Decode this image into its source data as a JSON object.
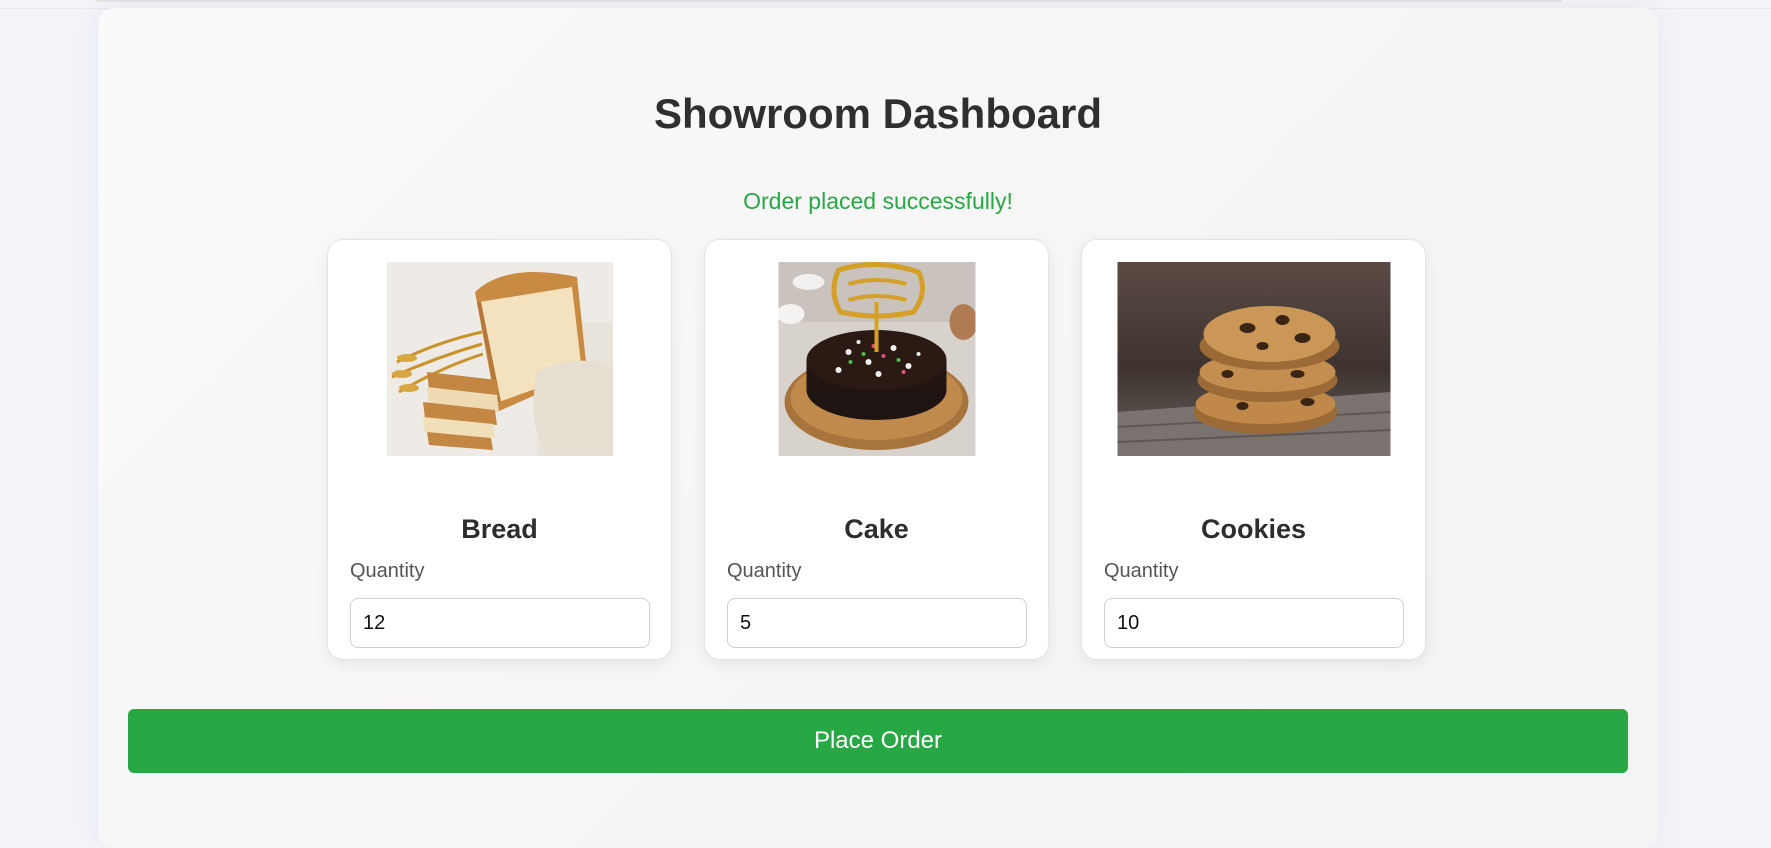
{
  "page": {
    "title": "Showroom Dashboard",
    "status_message": "Order placed successfully!"
  },
  "products": [
    {
      "name": "Bread",
      "quantity_label": "Quantity",
      "quantity": "12",
      "image": "bread-image"
    },
    {
      "name": "Cake",
      "quantity_label": "Quantity",
      "quantity": "5",
      "image": "cake-image"
    },
    {
      "name": "Cookies",
      "quantity_label": "Quantity",
      "quantity": "10",
      "image": "cookies-image"
    }
  ],
  "actions": {
    "place_order_label": "Place Order"
  },
  "colors": {
    "accent": "#28a745",
    "title": "#2f2f2f",
    "background": "#f2f4f9"
  }
}
